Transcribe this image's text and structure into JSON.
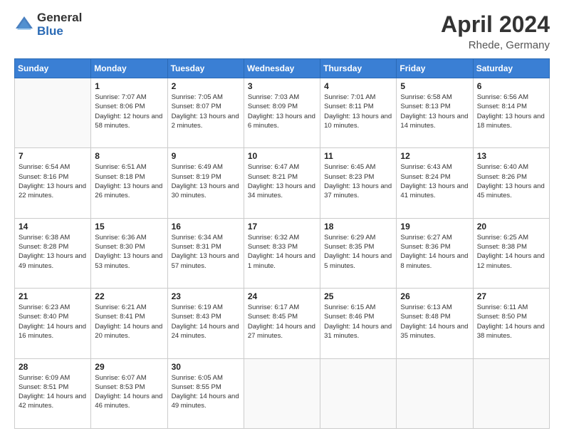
{
  "header": {
    "logo_general": "General",
    "logo_blue": "Blue",
    "title": "April 2024",
    "location": "Rhede, Germany"
  },
  "weekdays": [
    "Sunday",
    "Monday",
    "Tuesday",
    "Wednesday",
    "Thursday",
    "Friday",
    "Saturday"
  ],
  "weeks": [
    [
      {
        "day": "",
        "sunrise": "",
        "sunset": "",
        "daylight": ""
      },
      {
        "day": "1",
        "sunrise": "Sunrise: 7:07 AM",
        "sunset": "Sunset: 8:06 PM",
        "daylight": "Daylight: 12 hours and 58 minutes."
      },
      {
        "day": "2",
        "sunrise": "Sunrise: 7:05 AM",
        "sunset": "Sunset: 8:07 PM",
        "daylight": "Daylight: 13 hours and 2 minutes."
      },
      {
        "day": "3",
        "sunrise": "Sunrise: 7:03 AM",
        "sunset": "Sunset: 8:09 PM",
        "daylight": "Daylight: 13 hours and 6 minutes."
      },
      {
        "day": "4",
        "sunrise": "Sunrise: 7:01 AM",
        "sunset": "Sunset: 8:11 PM",
        "daylight": "Daylight: 13 hours and 10 minutes."
      },
      {
        "day": "5",
        "sunrise": "Sunrise: 6:58 AM",
        "sunset": "Sunset: 8:13 PM",
        "daylight": "Daylight: 13 hours and 14 minutes."
      },
      {
        "day": "6",
        "sunrise": "Sunrise: 6:56 AM",
        "sunset": "Sunset: 8:14 PM",
        "daylight": "Daylight: 13 hours and 18 minutes."
      }
    ],
    [
      {
        "day": "7",
        "sunrise": "Sunrise: 6:54 AM",
        "sunset": "Sunset: 8:16 PM",
        "daylight": "Daylight: 13 hours and 22 minutes."
      },
      {
        "day": "8",
        "sunrise": "Sunrise: 6:51 AM",
        "sunset": "Sunset: 8:18 PM",
        "daylight": "Daylight: 13 hours and 26 minutes."
      },
      {
        "day": "9",
        "sunrise": "Sunrise: 6:49 AM",
        "sunset": "Sunset: 8:19 PM",
        "daylight": "Daylight: 13 hours and 30 minutes."
      },
      {
        "day": "10",
        "sunrise": "Sunrise: 6:47 AM",
        "sunset": "Sunset: 8:21 PM",
        "daylight": "Daylight: 13 hours and 34 minutes."
      },
      {
        "day": "11",
        "sunrise": "Sunrise: 6:45 AM",
        "sunset": "Sunset: 8:23 PM",
        "daylight": "Daylight: 13 hours and 37 minutes."
      },
      {
        "day": "12",
        "sunrise": "Sunrise: 6:43 AM",
        "sunset": "Sunset: 8:24 PM",
        "daylight": "Daylight: 13 hours and 41 minutes."
      },
      {
        "day": "13",
        "sunrise": "Sunrise: 6:40 AM",
        "sunset": "Sunset: 8:26 PM",
        "daylight": "Daylight: 13 hours and 45 minutes."
      }
    ],
    [
      {
        "day": "14",
        "sunrise": "Sunrise: 6:38 AM",
        "sunset": "Sunset: 8:28 PM",
        "daylight": "Daylight: 13 hours and 49 minutes."
      },
      {
        "day": "15",
        "sunrise": "Sunrise: 6:36 AM",
        "sunset": "Sunset: 8:30 PM",
        "daylight": "Daylight: 13 hours and 53 minutes."
      },
      {
        "day": "16",
        "sunrise": "Sunrise: 6:34 AM",
        "sunset": "Sunset: 8:31 PM",
        "daylight": "Daylight: 13 hours and 57 minutes."
      },
      {
        "day": "17",
        "sunrise": "Sunrise: 6:32 AM",
        "sunset": "Sunset: 8:33 PM",
        "daylight": "Daylight: 14 hours and 1 minute."
      },
      {
        "day": "18",
        "sunrise": "Sunrise: 6:29 AM",
        "sunset": "Sunset: 8:35 PM",
        "daylight": "Daylight: 14 hours and 5 minutes."
      },
      {
        "day": "19",
        "sunrise": "Sunrise: 6:27 AM",
        "sunset": "Sunset: 8:36 PM",
        "daylight": "Daylight: 14 hours and 8 minutes."
      },
      {
        "day": "20",
        "sunrise": "Sunrise: 6:25 AM",
        "sunset": "Sunset: 8:38 PM",
        "daylight": "Daylight: 14 hours and 12 minutes."
      }
    ],
    [
      {
        "day": "21",
        "sunrise": "Sunrise: 6:23 AM",
        "sunset": "Sunset: 8:40 PM",
        "daylight": "Daylight: 14 hours and 16 minutes."
      },
      {
        "day": "22",
        "sunrise": "Sunrise: 6:21 AM",
        "sunset": "Sunset: 8:41 PM",
        "daylight": "Daylight: 14 hours and 20 minutes."
      },
      {
        "day": "23",
        "sunrise": "Sunrise: 6:19 AM",
        "sunset": "Sunset: 8:43 PM",
        "daylight": "Daylight: 14 hours and 24 minutes."
      },
      {
        "day": "24",
        "sunrise": "Sunrise: 6:17 AM",
        "sunset": "Sunset: 8:45 PM",
        "daylight": "Daylight: 14 hours and 27 minutes."
      },
      {
        "day": "25",
        "sunrise": "Sunrise: 6:15 AM",
        "sunset": "Sunset: 8:46 PM",
        "daylight": "Daylight: 14 hours and 31 minutes."
      },
      {
        "day": "26",
        "sunrise": "Sunrise: 6:13 AM",
        "sunset": "Sunset: 8:48 PM",
        "daylight": "Daylight: 14 hours and 35 minutes."
      },
      {
        "day": "27",
        "sunrise": "Sunrise: 6:11 AM",
        "sunset": "Sunset: 8:50 PM",
        "daylight": "Daylight: 14 hours and 38 minutes."
      }
    ],
    [
      {
        "day": "28",
        "sunrise": "Sunrise: 6:09 AM",
        "sunset": "Sunset: 8:51 PM",
        "daylight": "Daylight: 14 hours and 42 minutes."
      },
      {
        "day": "29",
        "sunrise": "Sunrise: 6:07 AM",
        "sunset": "Sunset: 8:53 PM",
        "daylight": "Daylight: 14 hours and 46 minutes."
      },
      {
        "day": "30",
        "sunrise": "Sunrise: 6:05 AM",
        "sunset": "Sunset: 8:55 PM",
        "daylight": "Daylight: 14 hours and 49 minutes."
      },
      {
        "day": "",
        "sunrise": "",
        "sunset": "",
        "daylight": ""
      },
      {
        "day": "",
        "sunrise": "",
        "sunset": "",
        "daylight": ""
      },
      {
        "day": "",
        "sunrise": "",
        "sunset": "",
        "daylight": ""
      },
      {
        "day": "",
        "sunrise": "",
        "sunset": "",
        "daylight": ""
      }
    ]
  ]
}
